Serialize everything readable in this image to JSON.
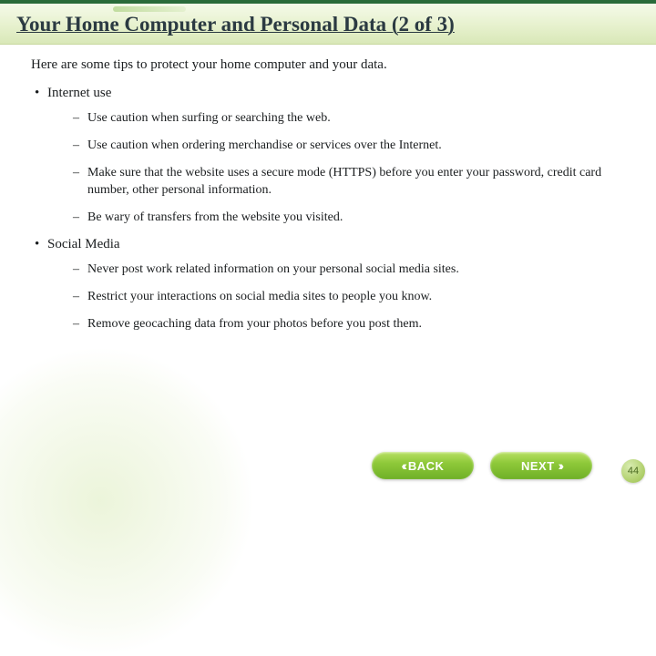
{
  "title": "Your Home Computer and Personal Data (2 of 3)",
  "intro": "Here are some tips to protect your home computer and your data.",
  "sections": [
    {
      "heading": "Internet use",
      "items": [
        "Use caution when surfing or searching the web.",
        "Use caution when ordering merchandise or services over the Internet.",
        "Make sure that the website uses a secure mode (HTTPS) before you enter your password, credit card number, other personal information.",
        "Be wary of transfers from the website you visited."
      ]
    },
    {
      "heading": "Social Media",
      "items": [
        "Never post work related information on your personal social media sites.",
        "Restrict your interactions on social media sites to people you know.",
        "Remove geocaching data from your photos before you post them."
      ]
    }
  ],
  "nav": {
    "back": "BACK",
    "next": "NEXT"
  },
  "page_number": "44"
}
